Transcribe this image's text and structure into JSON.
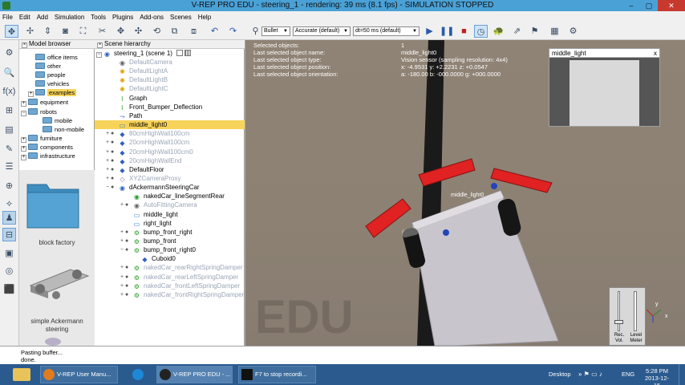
{
  "window": {
    "title": "V-REP PRO EDU - steering_1 - rendering: 39 ms (8.1 fps) - SIMULATION STOPPED",
    "controls": [
      "–",
      "▢",
      "✕"
    ]
  },
  "menubar": [
    "File",
    "Edit",
    "Add",
    "Simulation",
    "Tools",
    "Plugins",
    "Add-ons",
    "Scenes",
    "Help"
  ],
  "toolbar": {
    "engine_select": "Bullet",
    "accuracy_select": "Accurate (default)",
    "dt_select": "dt=50 ms (default)"
  },
  "model_browser": {
    "title": "Model browser",
    "items": [
      {
        "label": "office items",
        "indent": 1,
        "expander": ""
      },
      {
        "label": "other",
        "indent": 1,
        "expander": ""
      },
      {
        "label": "people",
        "indent": 1,
        "expander": ""
      },
      {
        "label": "vehicles",
        "indent": 1,
        "expander": ""
      },
      {
        "label": "examples",
        "indent": 1,
        "expander": "+",
        "selected": true
      },
      {
        "label": "equipment",
        "indent": 0,
        "expander": "+"
      },
      {
        "label": "robots",
        "indent": 0,
        "expander": "−"
      },
      {
        "label": "mobile",
        "indent": 2,
        "expander": ""
      },
      {
        "label": "non-mobile",
        "indent": 2,
        "expander": ""
      },
      {
        "label": "furniture",
        "indent": 0,
        "expander": "+"
      },
      {
        "label": "components",
        "indent": 0,
        "expander": "+"
      },
      {
        "label": "infrastructure",
        "indent": 0,
        "expander": "+"
      }
    ],
    "thumbnails": [
      {
        "label": "block factory"
      },
      {
        "label": "simple Ackermann steering"
      }
    ]
  },
  "scene_hierarchy": {
    "title": "Scene hierarchy",
    "root": "steering_1 (scene 1)",
    "items": [
      {
        "label": "DefaultCamera",
        "icon": "camera-icon",
        "glyph": "◉",
        "cls": "cam",
        "gray": true,
        "depth": 1,
        "exp": ""
      },
      {
        "label": "DefaultLightA",
        "icon": "light-icon",
        "glyph": "✺",
        "cls": "light",
        "gray": true,
        "depth": 1,
        "exp": ""
      },
      {
        "label": "DefaultLightB",
        "icon": "light-icon",
        "glyph": "✺",
        "cls": "light",
        "gray": true,
        "depth": 1,
        "exp": ""
      },
      {
        "label": "DefaultLightC",
        "icon": "light-icon",
        "glyph": "✺",
        "cls": "light",
        "gray": true,
        "depth": 1,
        "exp": ""
      },
      {
        "label": "Graph",
        "icon": "graph-icon",
        "glyph": "⌇",
        "cls": "graph",
        "gray": false,
        "depth": 1,
        "exp": ""
      },
      {
        "label": "Front_Bumper_Deflection",
        "icon": "graph-icon",
        "glyph": "⌇",
        "cls": "graph",
        "gray": false,
        "depth": 1,
        "exp": ""
      },
      {
        "label": "Path",
        "icon": "path-icon",
        "glyph": "⤳",
        "cls": "shape",
        "gray": false,
        "depth": 1,
        "exp": ""
      },
      {
        "label": "middle_light0",
        "icon": "vision-sensor-icon",
        "glyph": "▭",
        "cls": "sensor",
        "gray": false,
        "depth": 1,
        "exp": "",
        "selected": true
      },
      {
        "label": "80cmHighWall100cm",
        "icon": "shape-icon",
        "glyph": "◆",
        "cls": "shape",
        "gray": true,
        "depth": 1,
        "exp": "+"
      },
      {
        "label": "20cmHighWall100cm",
        "icon": "shape-icon",
        "glyph": "◆",
        "cls": "shape",
        "gray": true,
        "depth": 1,
        "exp": "+"
      },
      {
        "label": "20cmHighWall100cm0",
        "icon": "shape-icon",
        "glyph": "◆",
        "cls": "shape",
        "gray": true,
        "depth": 1,
        "exp": "+"
      },
      {
        "label": "20cmHighWallEnd",
        "icon": "shape-icon",
        "glyph": "◆",
        "cls": "shape",
        "gray": true,
        "depth": 1,
        "exp": "+"
      },
      {
        "label": "DefaultFloor",
        "icon": "shape-icon",
        "glyph": "◆",
        "cls": "shape",
        "gray": false,
        "depth": 1,
        "exp": "+"
      },
      {
        "label": "XYZCameraProxy",
        "icon": "dummy-icon",
        "glyph": "◇",
        "cls": "dummy",
        "gray": true,
        "depth": 1,
        "exp": "+"
      },
      {
        "label": "dAckermannSteeringCar",
        "icon": "model-icon",
        "glyph": "◉",
        "cls": "shape",
        "gray": false,
        "depth": 1,
        "exp": "−"
      },
      {
        "label": "nakedCar_lineSegmentRear",
        "icon": "model-icon",
        "glyph": "◉",
        "cls": "joint",
        "gray": false,
        "depth": 2,
        "exp": ""
      },
      {
        "label": "AutoFittingCamera",
        "icon": "camera-icon",
        "glyph": "◉",
        "cls": "cam",
        "gray": true,
        "depth": 2,
        "exp": "+"
      },
      {
        "label": "middle_light",
        "icon": "vision-sensor-icon",
        "glyph": "▭",
        "cls": "sensor",
        "gray": false,
        "depth": 2,
        "exp": ""
      },
      {
        "label": "right_light",
        "icon": "vision-sensor-icon",
        "glyph": "▭",
        "cls": "sensor",
        "gray": false,
        "depth": 2,
        "exp": ""
      },
      {
        "label": "bump_front_right",
        "icon": "joint-icon",
        "glyph": "⚙",
        "cls": "joint",
        "gray": false,
        "depth": 2,
        "exp": "+"
      },
      {
        "label": "bump_front",
        "icon": "joint-icon",
        "glyph": "⚙",
        "cls": "joint",
        "gray": false,
        "depth": 2,
        "exp": "+"
      },
      {
        "label": "bump_front_right0",
        "icon": "joint-icon",
        "glyph": "⚙",
        "cls": "joint",
        "gray": false,
        "depth": 2,
        "exp": "−"
      },
      {
        "label": "Cuboid0",
        "icon": "shape-icon",
        "glyph": "◆",
        "cls": "shape",
        "gray": false,
        "depth": 3,
        "exp": ""
      },
      {
        "label": "nakedCar_rearRightSpringDamper",
        "icon": "joint-icon",
        "glyph": "⚙",
        "cls": "joint",
        "gray": true,
        "depth": 2,
        "exp": "+"
      },
      {
        "label": "nakedCar_rearLeftSpringDamper",
        "icon": "joint-icon",
        "glyph": "⚙",
        "cls": "joint",
        "gray": true,
        "depth": 2,
        "exp": "+"
      },
      {
        "label": "nakedCar_frontLeftSpringDamper",
        "icon": "joint-icon",
        "glyph": "⚙",
        "cls": "joint",
        "gray": true,
        "depth": 2,
        "exp": "+"
      },
      {
        "label": "nakedCar_frontRightSpringDamper",
        "icon": "joint-icon",
        "glyph": "⚙",
        "cls": "joint",
        "gray": true,
        "depth": 2,
        "exp": "+"
      }
    ]
  },
  "scene_info": {
    "labels": [
      "Selected objects:",
      "Last selected object name:",
      "Last selected object type:",
      "Last selected object position:",
      "Last selected object orientation:"
    ],
    "selected_count": "1",
    "object_name": "middle_light0",
    "object_type": "Vision sensor (sampling resolution: 4x4)",
    "position": "x: -4.9531    y: +2.2231    z: +0.0547",
    "orientation": "a: -180.00    b: -000.0000    g: +000.0000"
  },
  "floating_view": {
    "title": "middle_light",
    "close": "x"
  },
  "scene_label": "middle_light0",
  "watermark": "EDU",
  "mixer": {
    "rec_label": "Rec.\nVol.",
    "level_label": "Level\nMeter",
    "axis_y": "y",
    "axis_x": "x"
  },
  "status": {
    "lines": [
      "Pasting buffer...",
      "done."
    ]
  },
  "taskbar": {
    "apps": [
      {
        "label": "V-REP User Manu...",
        "color": "#e07b1e"
      },
      {
        "label": "",
        "color": "#1e88d6"
      },
      {
        "label": "V-REP PRO EDU - ...",
        "color": "#222222"
      },
      {
        "label": "F7 to stop recordi...",
        "color": "#111111"
      }
    ],
    "desktop_label": "Desktop",
    "language": "ENG",
    "time": "5:28 PM",
    "date": "2013-12-15"
  },
  "colors": {
    "titlebar": "#4aa1d6",
    "selection": "#f7d35a",
    "taskbar": "#2b5a8e",
    "bumper_red": "#e02222",
    "vehicle_gray": "#c8c4cc"
  }
}
